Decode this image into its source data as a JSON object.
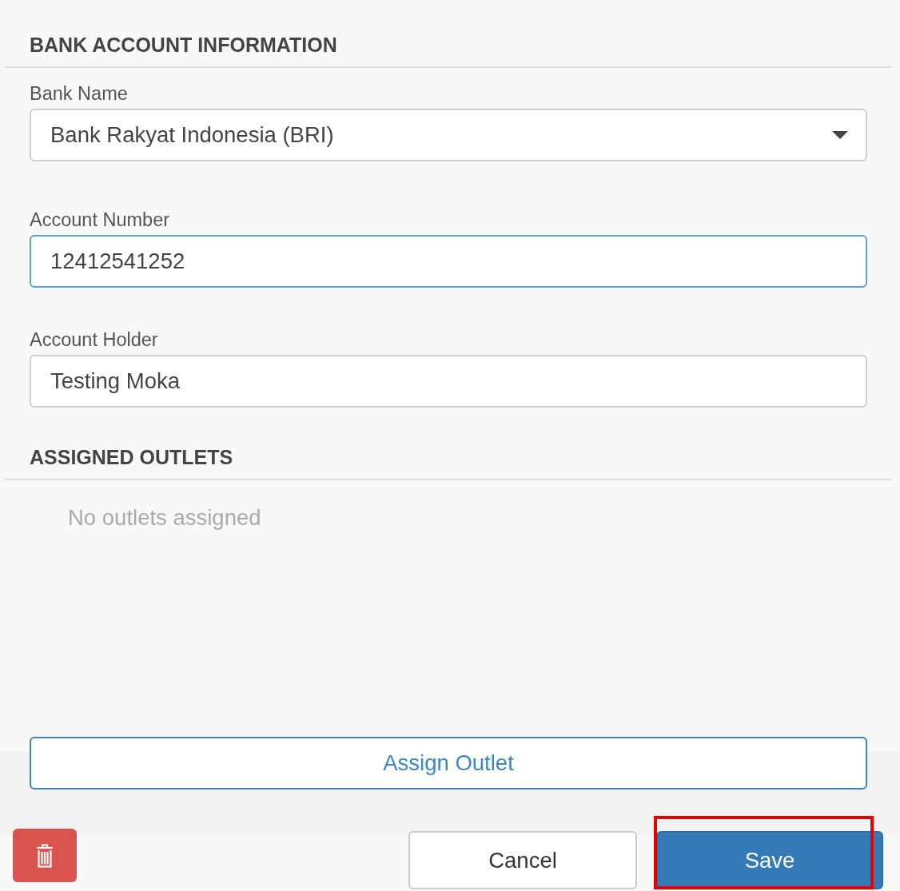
{
  "bank_section": {
    "heading": "BANK ACCOUNT INFORMATION",
    "fields": [
      {
        "kind": "select",
        "label": "Bank Name",
        "value": "Bank Rakyat Indonesia (BRI)",
        "focused": false
      },
      {
        "kind": "text",
        "label": "Account Number",
        "value": "12412541252",
        "focused": true
      },
      {
        "kind": "text",
        "label": "Account Holder",
        "value": "Testing Moka",
        "focused": false
      }
    ]
  },
  "outlets_section": {
    "heading": "ASSIGNED OUTLETS",
    "empty_message": "No outlets assigned",
    "assign_button": "Assign Outlet"
  },
  "footer": {
    "buttons": [
      {
        "kind": "delete",
        "highlighted": false
      },
      {
        "kind": "secondary",
        "label": "Cancel",
        "highlighted": false
      },
      {
        "kind": "primary",
        "label": "Save",
        "highlighted": true
      }
    ]
  }
}
